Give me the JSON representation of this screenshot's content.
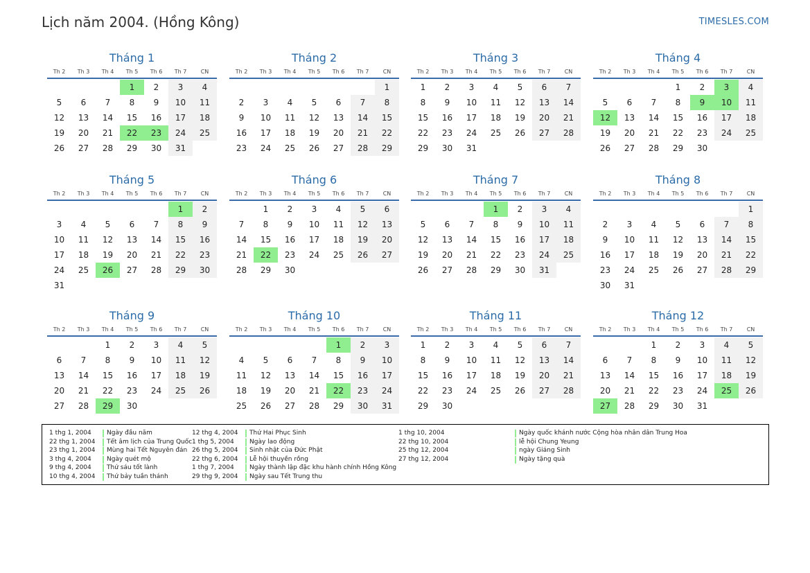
{
  "page": {
    "title": "Lịch năm 2004. (Hồng Kông)",
    "site": "TIMESLES.COM"
  },
  "colors": {
    "accent": "#2b6ca8",
    "holiday": "#90ee90",
    "weekend": "#f1f1f1"
  },
  "weekday_labels": [
    "Th 2",
    "Th 3",
    "Th 4",
    "Th 5",
    "Th 6",
    "Th 7",
    "CN"
  ],
  "months": [
    {
      "name": "Tháng 1",
      "offset": 3,
      "days": 31,
      "holidays": [
        1,
        22,
        23
      ]
    },
    {
      "name": "Tháng 2",
      "offset": 6,
      "days": 29,
      "holidays": []
    },
    {
      "name": "Tháng 3",
      "offset": 0,
      "days": 31,
      "holidays": []
    },
    {
      "name": "Tháng 4",
      "offset": 3,
      "days": 30,
      "holidays": [
        3,
        9,
        10,
        12
      ]
    },
    {
      "name": "Tháng 5",
      "offset": 5,
      "days": 31,
      "holidays": [
        1,
        26
      ]
    },
    {
      "name": "Tháng 6",
      "offset": 1,
      "days": 30,
      "holidays": [
        22
      ]
    },
    {
      "name": "Tháng 7",
      "offset": 3,
      "days": 31,
      "holidays": [
        1
      ]
    },
    {
      "name": "Tháng 8",
      "offset": 6,
      "days": 31,
      "holidays": []
    },
    {
      "name": "Tháng 9",
      "offset": 2,
      "days": 30,
      "holidays": [
        29
      ]
    },
    {
      "name": "Tháng 10",
      "offset": 4,
      "days": 31,
      "holidays": [
        1,
        22
      ]
    },
    {
      "name": "Tháng 11",
      "offset": 0,
      "days": 30,
      "holidays": []
    },
    {
      "name": "Tháng 12",
      "offset": 2,
      "days": 31,
      "holidays": [
        25,
        27
      ]
    }
  ],
  "legend": [
    [
      {
        "date": "1 thg 1, 2004",
        "name": "Ngày đầu năm"
      },
      {
        "date": "22 thg 1, 2004",
        "name": "Tết âm lịch của Trung Quốc"
      },
      {
        "date": "23 thg 1, 2004",
        "name": "Mùng hai Tết Nguyên đán"
      },
      {
        "date": "3 thg 4, 2004",
        "name": "Ngày quét mộ"
      },
      {
        "date": "9 thg 4, 2004",
        "name": "Thứ sáu tốt lành"
      },
      {
        "date": "10 thg 4, 2004",
        "name": "Thứ bảy tuần thánh"
      }
    ],
    [
      {
        "date": "12 thg 4, 2004",
        "name": "Thứ Hai Phục Sinh"
      },
      {
        "date": "1 thg 5, 2004",
        "name": "Ngày lao động"
      },
      {
        "date": "26 thg 5, 2004",
        "name": "Sinh nhật của Đức Phật"
      },
      {
        "date": "22 thg 6, 2004",
        "name": "Lễ hội thuyền rồng"
      },
      {
        "date": "1 thg 7, 2004",
        "name": "Ngày thành lập đặc khu hành chính Hồng Kông"
      },
      {
        "date": "29 thg 9, 2004",
        "name": "Ngày sau Tết Trung thu"
      }
    ],
    [
      {
        "date": "1 thg 10, 2004",
        "name": "Ngày quốc khánh nước Cộng hòa nhân dân Trung Hoa"
      },
      {
        "date": "22 thg 10, 2004",
        "name": "lễ hội Chung Yeung"
      },
      {
        "date": "25 thg 12, 2004",
        "name": "ngày Giáng Sinh"
      },
      {
        "date": "27 thg 12, 2004",
        "name": "Ngày tặng quà"
      }
    ]
  ]
}
